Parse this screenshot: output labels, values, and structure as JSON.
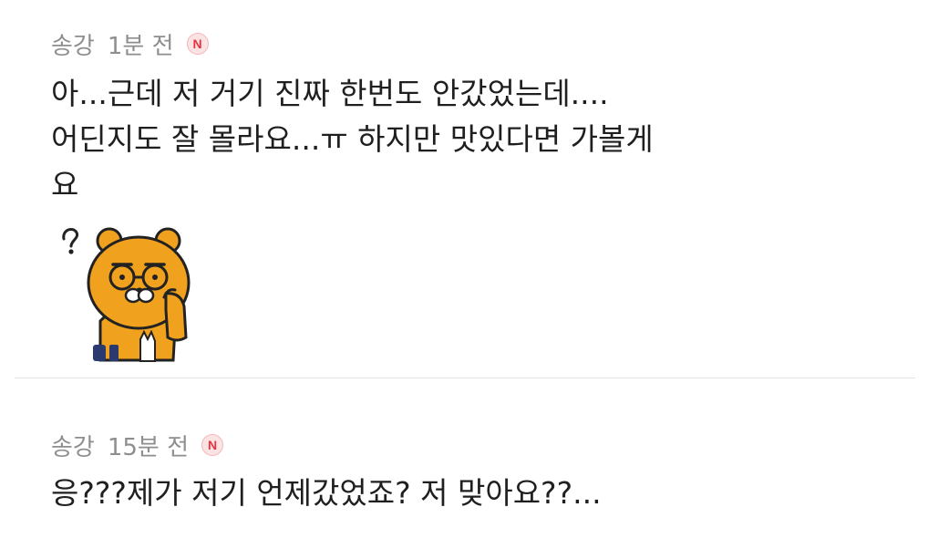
{
  "comments": [
    {
      "author": "송강",
      "time": "1분 전",
      "badge": "N",
      "lines": [
        "아...근데 저 거기 진짜 한번도 안갔었는데....",
        "어딘지도 잘 몰라요...ㅠ 하지만 맛있다면 가볼게",
        "요"
      ],
      "sticker": "ryan-thinking-sticker"
    },
    {
      "author": "송강",
      "time": "15분 전",
      "badge": "N",
      "lines": [
        "응???제가 저기 언제갔었죠? 저 맞아요??..."
      ]
    }
  ],
  "colors": {
    "meta_text": "#8e8e8e",
    "body_text": "#1f1f1f",
    "badge_red": "#e6333f",
    "divider": "#e4e4e4",
    "ryan_orange": "#f0a21e"
  }
}
